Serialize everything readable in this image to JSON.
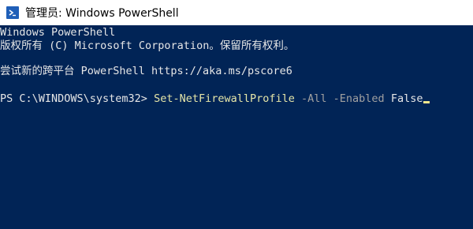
{
  "window": {
    "title": "管理员: Windows PowerShell",
    "icon": "powershell-icon",
    "accent": "#1f5fb8"
  },
  "console": {
    "background": "#012456",
    "banner_line1": "Windows PowerShell",
    "banner_line2": "版权所有 (C) Microsoft Corporation。保留所有权利。",
    "banner_line3": "尝试新的跨平台 PowerShell https://aka.ms/pscore6",
    "prompt": "PS C:\\WINDOWS\\system32> ",
    "command": "Set-NetFirewallProfile",
    "param1": " -All",
    "param2": " -Enabled",
    "value": " False"
  }
}
